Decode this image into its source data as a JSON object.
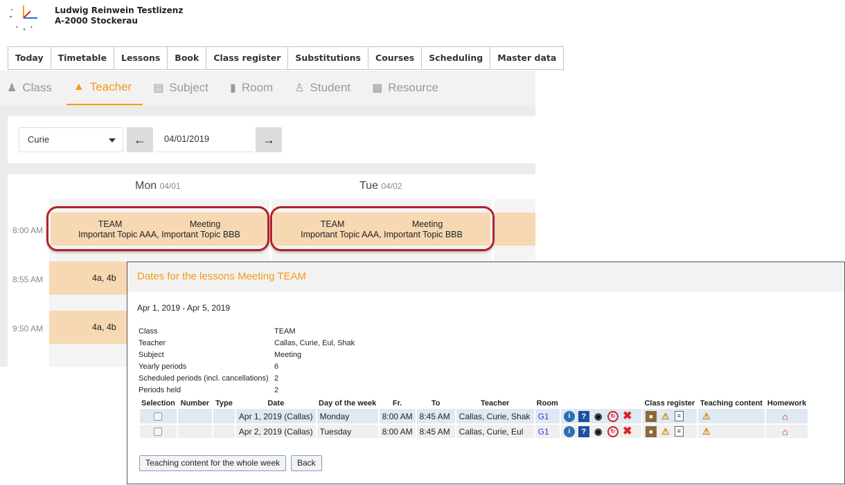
{
  "header": {
    "line1": "Ludwig Reinwein Testlizenz",
    "line2": "A-2000 Stockerau"
  },
  "mainnav": [
    "Today",
    "Timetable",
    "Lessons",
    "Book",
    "Class register",
    "Substitutions",
    "Courses",
    "Scheduling",
    "Master data"
  ],
  "subnav": {
    "items": [
      {
        "label": "Class",
        "icon": "class-icon"
      },
      {
        "label": "Teacher",
        "icon": "graduation-cap-icon",
        "active": true
      },
      {
        "label": "Subject",
        "icon": "book-icon"
      },
      {
        "label": "Room",
        "icon": "door-icon"
      },
      {
        "label": "Student",
        "icon": "student-icon"
      },
      {
        "label": "Resource",
        "icon": "projector-icon"
      }
    ]
  },
  "filter": {
    "teacher": "Curie",
    "date": "04/01/2019"
  },
  "timetable": {
    "days": [
      {
        "name": "Mon",
        "date": "04/01"
      },
      {
        "name": "Tue",
        "date": "04/02"
      }
    ],
    "times": [
      "8:00 AM",
      "8:55 AM",
      "9:50 AM"
    ],
    "meeting": {
      "class": "TEAM",
      "subject": "Meeting",
      "topics": "Important Topic AAA, Important Topic BBB"
    },
    "lesson_class": "4a, 4b"
  },
  "dialog": {
    "title": "Dates for the lessons Meeting TEAM",
    "range": "Apr 1, 2019 - Apr 5, 2019",
    "info": [
      {
        "k": "Class",
        "v": "TEAM"
      },
      {
        "k": "Teacher",
        "v": "Callas, Curie, Eul, Shak"
      },
      {
        "k": "Subject",
        "v": "Meeting"
      },
      {
        "k": "Yearly periods",
        "v": "6"
      },
      {
        "k": "Scheduled periods (incl. cancellations)",
        "v": "2"
      },
      {
        "k": "Periods held",
        "v": "2"
      }
    ],
    "columns": {
      "selection": "Selection",
      "number": "Number",
      "type": "Type",
      "date": "Date",
      "dow": "Day of the week",
      "from": "Fr.",
      "to": "To",
      "teacher": "Teacher",
      "room": "Room",
      "classreg": "Class register",
      "teaching": "Teaching content",
      "homework": "Homework"
    },
    "rows": [
      {
        "date": "Apr 1, 2019 (Callas)",
        "dow": "Monday",
        "from": "8:00 AM",
        "to": "8:45 AM",
        "teacher": "Callas, Curie, Shak",
        "room": "G1"
      },
      {
        "date": "Apr 2, 2019 (Callas)",
        "dow": "Tuesday",
        "from": "8:00 AM",
        "to": "8:45 AM",
        "teacher": "Callas, Curie, Eul",
        "room": "G1"
      }
    ],
    "buttons": {
      "teaching_week": "Teaching content for the whole week",
      "back": "Back"
    },
    "colors": {
      "accent": "#f39c12",
      "lesson": "#f6d8b3",
      "ring": "#b0202a"
    }
  }
}
